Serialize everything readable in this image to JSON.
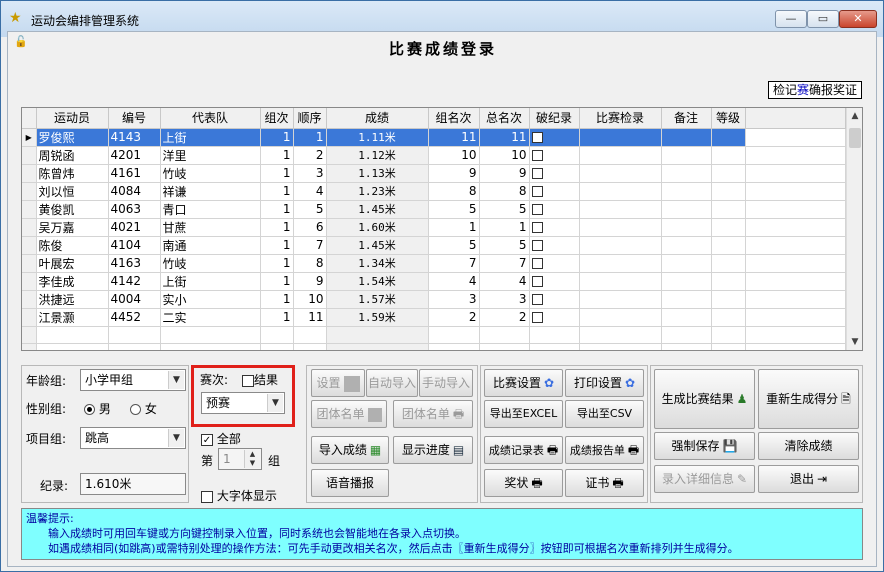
{
  "window": {
    "title": "运动会编排管理系统",
    "min": "—",
    "max": "▭",
    "close": "✕"
  },
  "page_title": "比赛成绩登录",
  "btn_records": {
    "part1": "检记",
    "hl": "赛",
    "part2": "确报奖证"
  },
  "grid": {
    "headers": [
      "运动员",
      "编号",
      "代表队",
      "组次",
      "顺序",
      "成绩",
      "组名次",
      "总名次",
      "破纪录",
      "比赛检录",
      "备注",
      "等级"
    ],
    "rows": [
      [
        "罗俊熙",
        "4143",
        "上街",
        "1",
        "1",
        "1.11米",
        "11",
        "11"
      ],
      [
        "周锐函",
        "4201",
        "洋里",
        "1",
        "2",
        "1.12米",
        "10",
        "10"
      ],
      [
        "陈曾炜",
        "4161",
        "竹岐",
        "1",
        "3",
        "1.13米",
        "9",
        "9"
      ],
      [
        "刘以恒",
        "4084",
        "祥谦",
        "1",
        "4",
        "1.23米",
        "8",
        "8"
      ],
      [
        "黄俊凯",
        "4063",
        "青口",
        "1",
        "5",
        "1.45米",
        "5",
        "5"
      ],
      [
        "吴万嘉",
        "4021",
        "甘蔗",
        "1",
        "6",
        "1.60米",
        "1",
        "1"
      ],
      [
        "陈俊",
        "4104",
        "南通",
        "1",
        "7",
        "1.45米",
        "5",
        "5"
      ],
      [
        "叶展宏",
        "4163",
        "竹岐",
        "1",
        "8",
        "1.34米",
        "7",
        "7"
      ],
      [
        "李佳成",
        "4142",
        "上街",
        "1",
        "9",
        "1.54米",
        "4",
        "4"
      ],
      [
        "洪捷远",
        "4004",
        "实小",
        "1",
        "10",
        "1.57米",
        "3",
        "3"
      ],
      [
        "江景灏",
        "4452",
        "二实",
        "1",
        "11",
        "1.59米",
        "2",
        "2"
      ]
    ]
  },
  "filters": {
    "age_label": "年龄组:",
    "age_value": "小学甲组",
    "gender_label": "性别组:",
    "male": "男",
    "female": "女",
    "event_label": "项目组:",
    "event_value": "跳高",
    "record_label": "纪录:",
    "record_value": "1.610米"
  },
  "round": {
    "label": "赛次:",
    "final_label": "结果",
    "value": "预赛",
    "all_label": "全部",
    "group_prefix": "第",
    "group_value": "1",
    "group_suffix": "组",
    "bigfont_label": "大字体显示"
  },
  "buttons": {
    "setup": "设置",
    "auto_import": "自动导入",
    "manual_import": "手动导入",
    "team_list1": "团体名单",
    "team_list2": "团体名单",
    "import_scores": "导入成绩",
    "show_progress": "显示进度",
    "voice": "语音播报",
    "match_setup": "比赛设置",
    "print_setup": "打印设置",
    "export_excel": "导出至EXCEL",
    "export_csv": "导出至CSV",
    "record_table": "成绩记录表",
    "report_sheet": "成绩报告单",
    "award": "奖状",
    "certificate": "证书",
    "gen_result": "生成比赛结果",
    "regen_score": "重新生成得分",
    "force_save": "强制保存",
    "clear_scores": "清除成绩",
    "detail_entry": "录入详细信息",
    "exit": "退出"
  },
  "tips": {
    "title": "温馨提示:",
    "line1": "输入成绩时可用回车键或方向键控制录入位置，同时系统也会智能地在各录入点切换。",
    "line2": "如遇成绩相同(如跳高)或需特别处理的操作方法：可先手动更改相关名次，然后点击〖重新生成得分〗按钮即可根据名次重新排列并生成得分。"
  }
}
